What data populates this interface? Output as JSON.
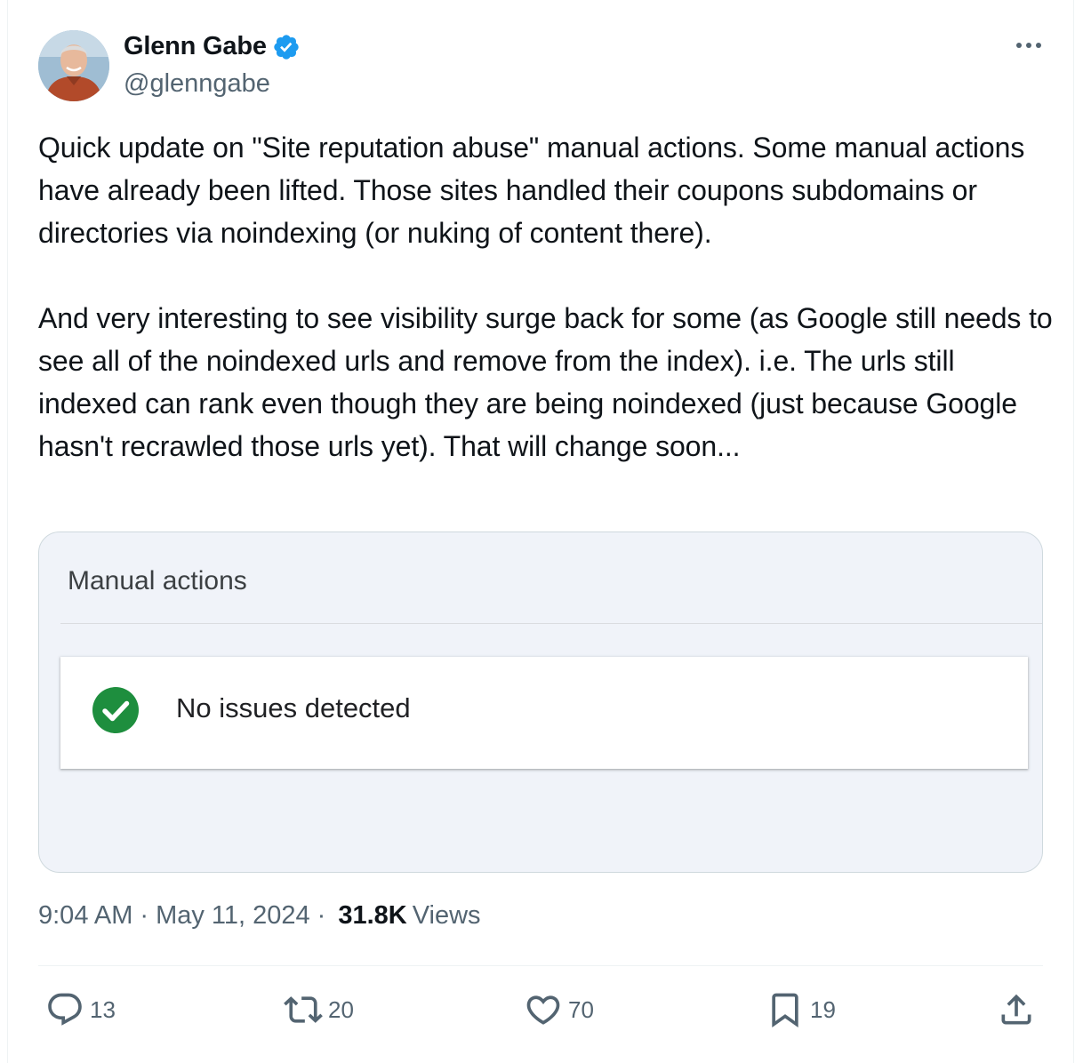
{
  "author": {
    "display_name": "Glenn Gabe",
    "handle": "@glenngabe",
    "verified_color": "#1d9bf0"
  },
  "tweet": {
    "text": "Quick update on \"Site reputation abuse\" manual actions. Some manual actions have already been lifted. Those sites handled their coupons subdomains or directories via noindexing (or nuking of content there).\n\nAnd very interesting to see visibility surge back for some (as Google still needs to see all of the noindexed urls and remove from the index). i.e. The urls still indexed can rank even though they are being noindexed (just because Google hasn't recrawled those urls yet). That will change soon..."
  },
  "media": {
    "panel_title": "Manual actions",
    "status_text": "No issues detected",
    "status_icon": "check-circle-icon",
    "status_color": "#1e8e3e"
  },
  "meta": {
    "time": "9:04 AM",
    "date": "May 11, 2024",
    "views_count": "31.8K",
    "views_label": "Views",
    "separator": "·"
  },
  "actions": {
    "replies": "13",
    "reposts": "20",
    "likes": "70",
    "bookmarks": "19"
  }
}
